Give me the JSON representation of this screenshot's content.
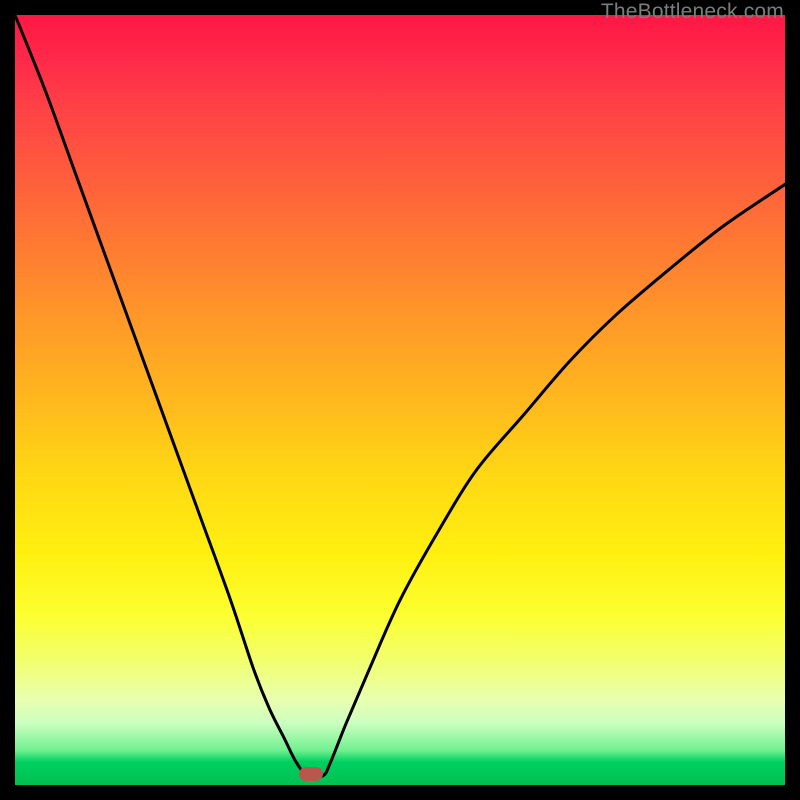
{
  "watermark": "TheBottleneck.com",
  "marker": {
    "x_pct": 38.5,
    "y_pct": 98.6
  },
  "chart_data": {
    "type": "line",
    "title": "",
    "xlabel": "",
    "ylabel": "",
    "xlim": [
      0,
      100
    ],
    "ylim": [
      0,
      100
    ],
    "series": [
      {
        "name": "bottleneck-curve",
        "x": [
          0,
          4,
          8,
          12,
          16,
          20,
          24,
          28,
          31,
          33,
          35,
          36.5,
          38,
          40,
          41,
          43,
          46,
          50,
          55,
          60,
          66,
          72,
          78,
          85,
          92,
          100
        ],
        "y": [
          100,
          90,
          79,
          68,
          57,
          46,
          35,
          24,
          15,
          10,
          6,
          3,
          1.2,
          1.2,
          3,
          8,
          15,
          24,
          33,
          41,
          48,
          55,
          61,
          67,
          72.6,
          78
        ]
      }
    ],
    "annotations": [
      {
        "name": "optimum-marker",
        "x": 38.5,
        "y": 1.4
      }
    ],
    "gradient_stops": [
      {
        "pct": 0,
        "color": "#ff1744"
      },
      {
        "pct": 50,
        "color": "#ffb81e"
      },
      {
        "pct": 80,
        "color": "#fcff30"
      },
      {
        "pct": 97,
        "color": "#00d060"
      },
      {
        "pct": 100,
        "color": "#00c050"
      }
    ]
  }
}
